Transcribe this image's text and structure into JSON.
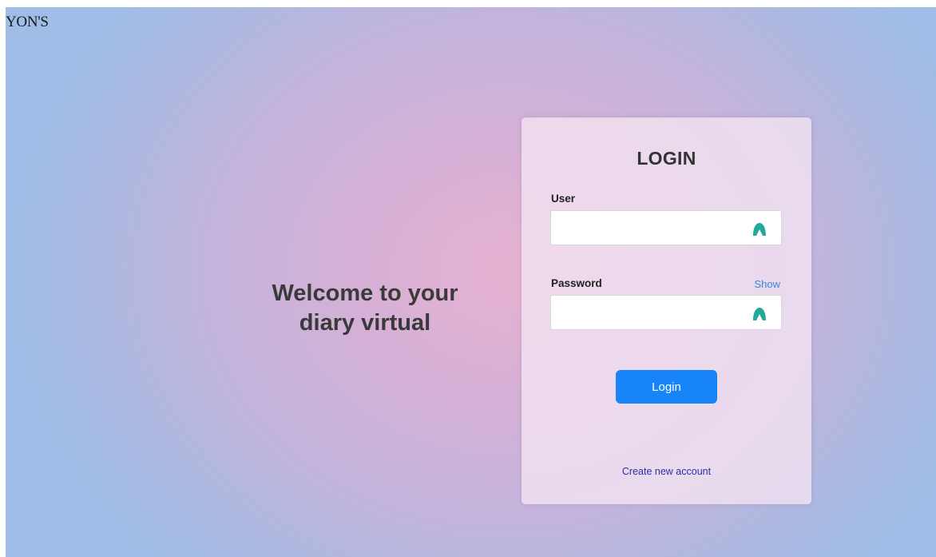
{
  "brand": {
    "name": "YON'S"
  },
  "hero": {
    "line1": "Welcome to your",
    "line2": "diary virtual"
  },
  "login_form": {
    "title": "LOGIN",
    "user_label": "User",
    "user_value": "",
    "password_label": "Password",
    "password_value": "",
    "show_label": "Show",
    "submit_label": "Login",
    "create_account_label": "Create new account",
    "field_icon": "password-manager-icon"
  },
  "colors": {
    "accent": "#1784f7",
    "show_link": "#3a86d8",
    "create_link": "#2b2fa8",
    "field_icon": "#22a99a"
  }
}
